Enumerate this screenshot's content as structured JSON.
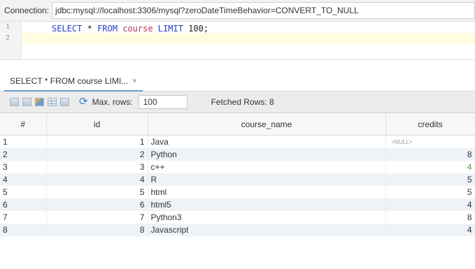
{
  "connection": {
    "label": "Connection:",
    "url": "jdbc:mysql://localhost:3306/mysql?zeroDateTimeBehavior=CONVERT_TO_NULL"
  },
  "editor": {
    "line_numbers": [
      "1",
      "2"
    ],
    "tokens": {
      "select": "SELECT",
      "star": "*",
      "from": "FROM",
      "table": "course",
      "limit": "LIMIT",
      "value": "100",
      "semicolon": ";"
    }
  },
  "result_tab": {
    "label": "SELECT * FROM course LIMI...",
    "close": "×"
  },
  "toolbar": {
    "max_rows_label": "Max. rows:",
    "max_rows_value": "100",
    "fetched_rows": "Fetched Rows: 8",
    "refresh_glyph": "⟳"
  },
  "table": {
    "columns": [
      "#",
      "id",
      "course_name",
      "credits"
    ],
    "rows": [
      {
        "num": "1",
        "id": "1",
        "name": "Java",
        "credits": "<NULL>"
      },
      {
        "num": "2",
        "id": "2",
        "name": "Python",
        "credits": "8"
      },
      {
        "num": "3",
        "id": "3",
        "name": "c++",
        "credits": "4"
      },
      {
        "num": "4",
        "id": "4",
        "name": "R",
        "credits": "5"
      },
      {
        "num": "5",
        "id": "5",
        "name": "html",
        "credits": "5"
      },
      {
        "num": "6",
        "id": "6",
        "name": "html5",
        "credits": "4"
      },
      {
        "num": "7",
        "id": "7",
        "name": "Python3",
        "credits": "8"
      },
      {
        "num": "8",
        "id": "8",
        "name": "Javascript",
        "credits": "4"
      }
    ]
  },
  "colors": {
    "keyword": "#2a40c9",
    "table_name": "#b0355e",
    "row_alt": "#eef3f8",
    "credit_green": "#4aa23a"
  }
}
